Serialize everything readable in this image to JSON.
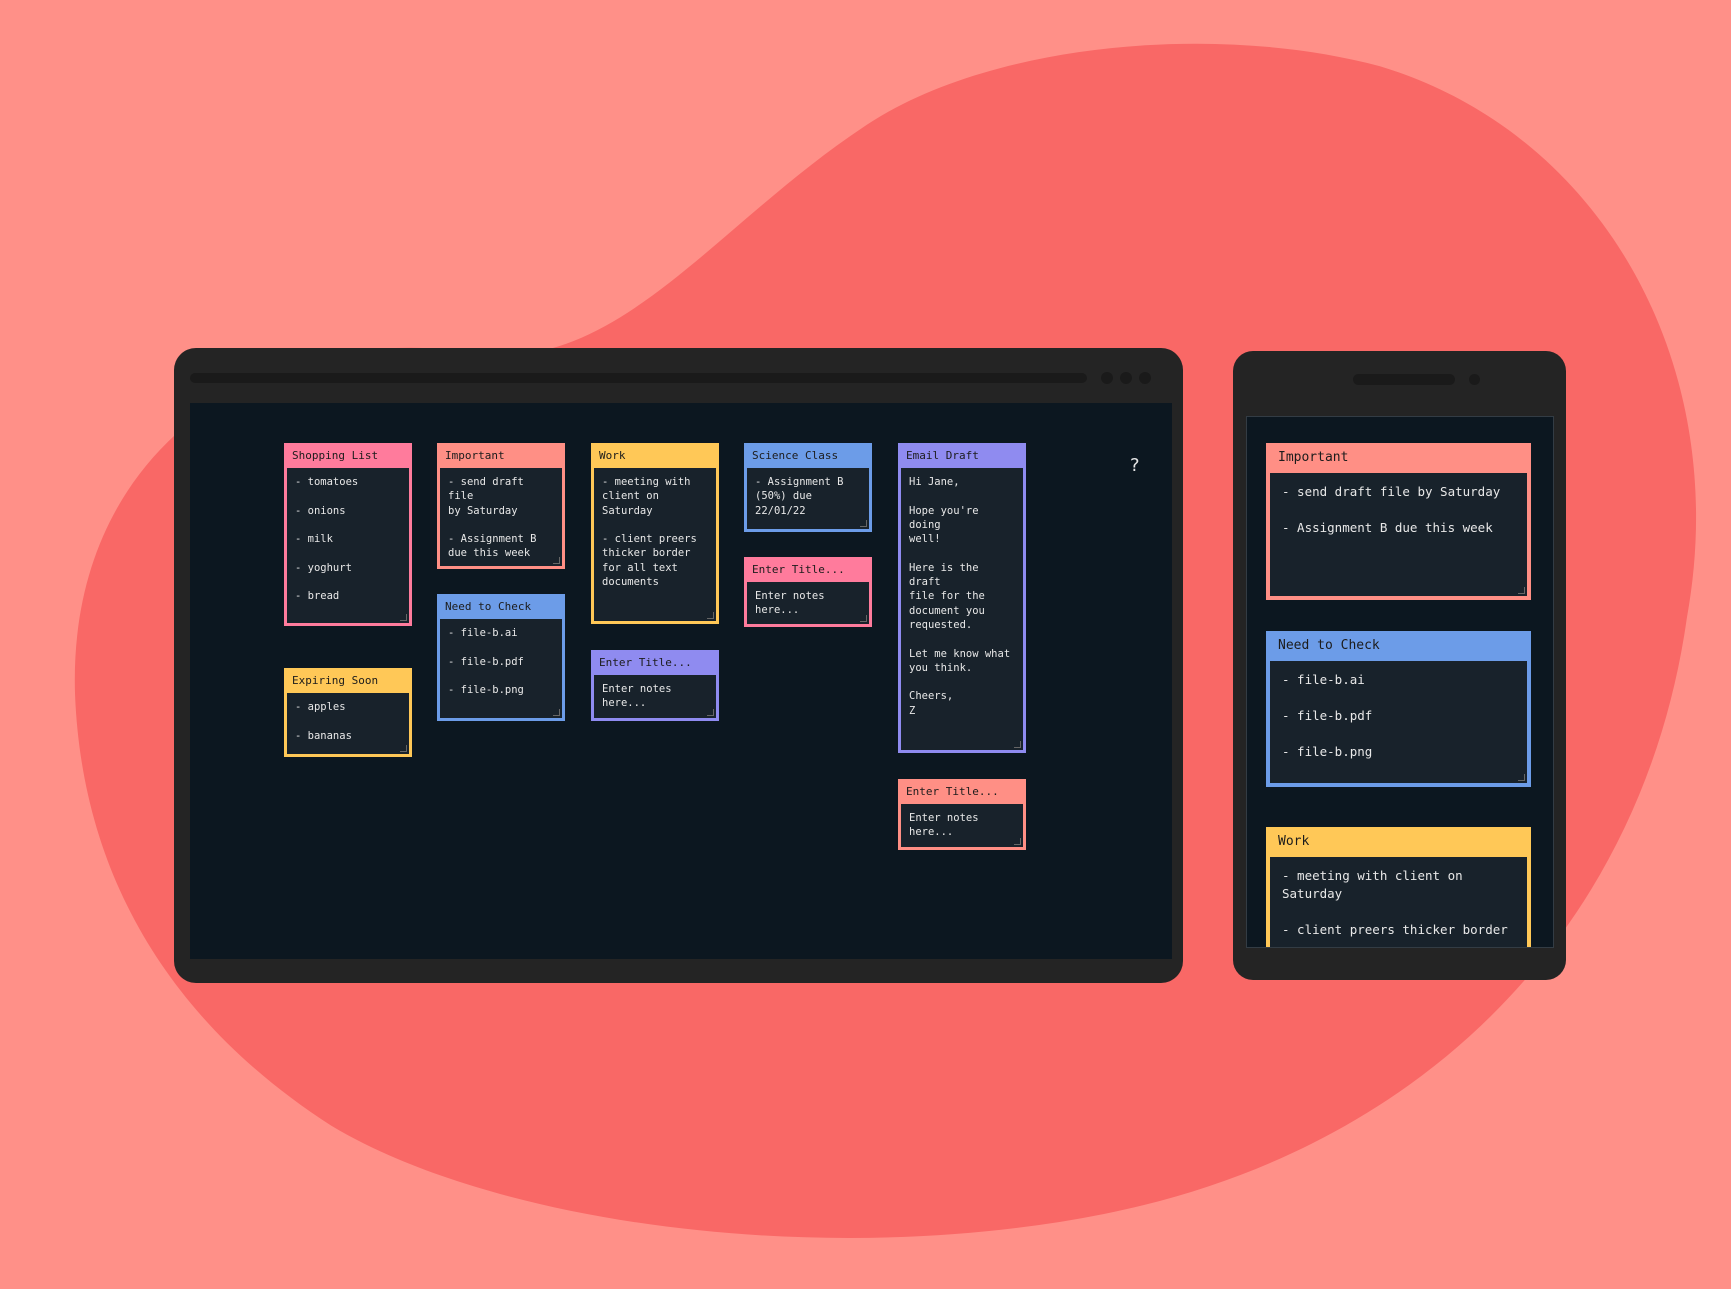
{
  "colors": {
    "background": "#ff9088",
    "blob": "#f96866",
    "device_frame": "#242424",
    "screen": "#0c1720",
    "note_body": "#18222b",
    "pink": "#ff7b9c",
    "salmon": "#ff8f85",
    "yellow": "#ffc857",
    "blue": "#6c9ce8",
    "purple": "#8f8bf0"
  },
  "desktop": {
    "help_label": "?",
    "notes": [
      {
        "id": "shopping-list",
        "title": "Shopping List",
        "body": "- tomatoes\n\n- onions\n\n- milk\n\n- yoghurt\n\n- bread",
        "color": "pink"
      },
      {
        "id": "expiring-soon",
        "title": "Expiring Soon",
        "body": "- apples\n\n- bananas",
        "color": "yellow"
      },
      {
        "id": "important",
        "title": "Important",
        "body": "- send draft file\nby Saturday\n\n- Assignment B\ndue this week",
        "color": "salmon"
      },
      {
        "id": "need-to-check",
        "title": "Need to Check",
        "body": "- file-b.ai\n\n- file-b.pdf\n\n- file-b.png",
        "color": "blue"
      },
      {
        "id": "work",
        "title": "Work",
        "body": "- meeting with\nclient on\nSaturday\n\n- client preers\nthicker border\nfor all text\ndocuments",
        "color": "yellow"
      },
      {
        "id": "new-note-purple",
        "title": "Enter Title...",
        "body": "Enter notes\nhere...",
        "color": "purple"
      },
      {
        "id": "science-class",
        "title": "Science Class",
        "body": "- Assignment B\n(50%) due\n22/01/22",
        "color": "blue"
      },
      {
        "id": "new-note-pink",
        "title": "Enter Title...",
        "body": "Enter notes\nhere...",
        "color": "pink"
      },
      {
        "id": "email-draft",
        "title": "Email Draft",
        "body": "Hi Jane,\n\nHope you're doing\nwell!\n\nHere is the draft\nfile for the\ndocument you\nrequested.\n\nLet me know what\nyou think.\n\nCheers,\nZ",
        "color": "purple"
      },
      {
        "id": "new-note-salmon",
        "title": "Enter Title...",
        "body": "Enter notes\nhere...",
        "color": "salmon"
      }
    ]
  },
  "mobile": {
    "notes": [
      {
        "id": "important",
        "title": "Important",
        "body": "- send draft file by Saturday\n\n- Assignment B due this week",
        "color": "salmon"
      },
      {
        "id": "need-to-check",
        "title": "Need to Check",
        "body": "- file-b.ai\n\n- file-b.pdf\n\n- file-b.png",
        "color": "blue"
      },
      {
        "id": "work",
        "title": "Work",
        "body": "- meeting with client on\nSaturday\n\n- client preers thicker border",
        "color": "yellow"
      }
    ]
  }
}
